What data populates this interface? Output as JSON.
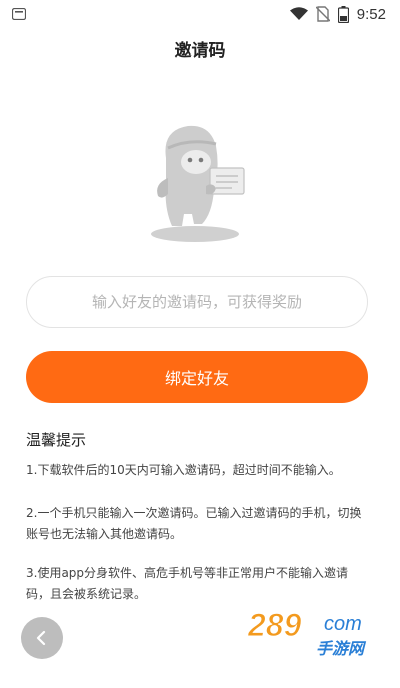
{
  "status_bar": {
    "time": "9:52",
    "battery_level": "5"
  },
  "page": {
    "title": "邀请码"
  },
  "invite_input": {
    "placeholder": "输入好友的邀请码，可获得奖励",
    "value": ""
  },
  "bind_button": {
    "label": "绑定好友"
  },
  "tips": {
    "heading": "温馨提示",
    "items": [
      "1.下载软件后的10天内可输入邀请码，超过时间不能输入。",
      "2.一个手机只能输入一次邀请码。已输入过邀请码的手机，切换账号也无法输入其他邀请码。",
      "3.使用app分身软件、高危手机号等非正常用户不能输入邀请码，且会被系统记录。"
    ]
  },
  "watermark": {
    "brand": "289",
    "suffix": "com",
    "sub": "手游网"
  },
  "colors": {
    "accent": "#ff6a13",
    "mascot": "#c9c9c9",
    "watermark_orange": "#f39a1e",
    "watermark_blue": "#2a7fd6"
  }
}
